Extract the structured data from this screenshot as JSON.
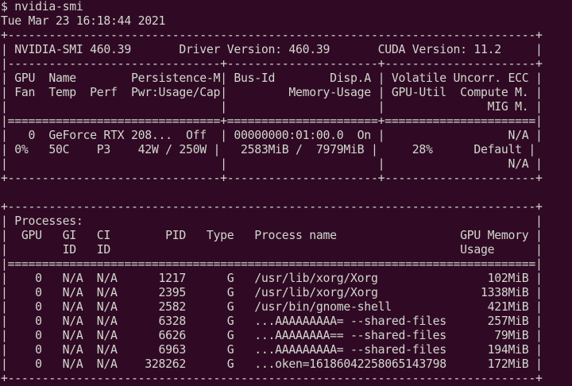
{
  "terminal": {
    "prompt_command": "$ nvidia-smi",
    "timestamp": "Tue Mar 23 16:18:44 2021",
    "smi_lines": [
      "+-----------------------------------------------------------------------------+",
      "| NVIDIA-SMI 460.39       Driver Version: 460.39       CUDA Version: 11.2     |",
      "|-------------------------------+----------------------+----------------------+",
      "| GPU  Name        Persistence-M| Bus-Id        Disp.A | Volatile Uncorr. ECC |",
      "| Fan  Temp  Perf  Pwr:Usage/Cap|         Memory-Usage | GPU-Util  Compute M. |",
      "|                               |                      |               MIG M. |",
      "|===============================+======================+======================|",
      "|   0  GeForce RTX 208...  Off  | 00000000:01:00.0  On |                  N/A |",
      "| 0%   50C    P3    42W / 250W |   2583MiB /  7979MiB |     28%      Default |",
      "|                               |                      |                  N/A |",
      "+-------------------------------+----------------------+----------------------+",
      "",
      "+-----------------------------------------------------------------------------+",
      "| Processes:                                                                  |",
      "|  GPU   GI   CI        PID   Type   Process name                  GPU Memory |",
      "|        ID   ID                                                   Usage      |",
      "|=============================================================================|",
      "|    0   N/A  N/A      1217      G   /usr/lib/xorg/Xorg                102MiB |",
      "|    0   N/A  N/A      2395      G   /usr/lib/xorg/Xorg               1338MiB |",
      "|    0   N/A  N/A      2582      G   /usr/bin/gnome-shell              421MiB |",
      "|    0   N/A  N/A      6328      G   ...AAAAAAAAA= --shared-files      257MiB |",
      "|    0   N/A  N/A      6626      G   ...AAAAAAAA== --shared-files       79MiB |",
      "|    0   N/A  N/A      6963      G   ...AAAAAAAAA= --shared-files      194MiB |",
      "|    0   N/A  N/A    328262      G   ...oken=16186042258065143798      172MiB |",
      "+-----------------------------------------------------------------------------+"
    ]
  },
  "colors": {
    "background": "#300a24",
    "text": "#d3d7cf"
  }
}
